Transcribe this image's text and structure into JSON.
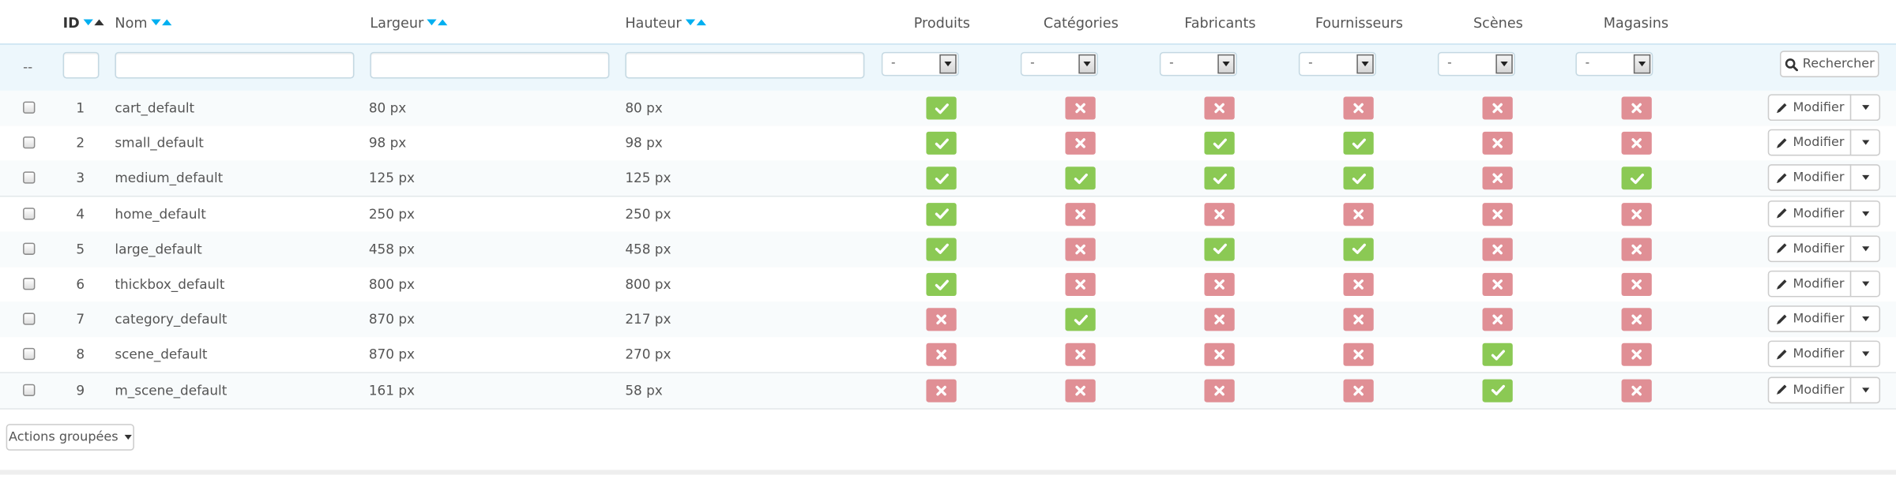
{
  "header": {
    "columns": [
      {
        "label": "ID"
      },
      {
        "label": "Nom"
      },
      {
        "label": "Largeur"
      },
      {
        "label": "Hauteur"
      },
      {
        "label": "Produits"
      },
      {
        "label": "Catégories"
      },
      {
        "label": "Fabricants"
      },
      {
        "label": "Fournisseurs"
      },
      {
        "label": "Scènes"
      },
      {
        "label": "Magasins"
      }
    ]
  },
  "filters": {
    "dash": "--",
    "select_value": "-",
    "search_label": "Rechercher"
  },
  "rows": [
    {
      "id": "1",
      "name": "cart_default",
      "width": "80 px",
      "height": "80 px",
      "flags": [
        true,
        false,
        false,
        false,
        false,
        false
      ]
    },
    {
      "id": "2",
      "name": "small_default",
      "width": "98 px",
      "height": "98 px",
      "flags": [
        true,
        false,
        true,
        true,
        false,
        false
      ]
    },
    {
      "id": "3",
      "name": "medium_default",
      "width": "125 px",
      "height": "125 px",
      "flags": [
        true,
        true,
        true,
        true,
        false,
        true
      ]
    },
    {
      "id": "4",
      "name": "home_default",
      "width": "250 px",
      "height": "250 px",
      "flags": [
        true,
        false,
        false,
        false,
        false,
        false
      ]
    },
    {
      "id": "5",
      "name": "large_default",
      "width": "458 px",
      "height": "458 px",
      "flags": [
        true,
        false,
        true,
        true,
        false,
        false
      ]
    },
    {
      "id": "6",
      "name": "thickbox_default",
      "width": "800 px",
      "height": "800 px",
      "flags": [
        true,
        false,
        false,
        false,
        false,
        false
      ]
    },
    {
      "id": "7",
      "name": "category_default",
      "width": "870 px",
      "height": "217 px",
      "flags": [
        false,
        true,
        false,
        false,
        false,
        false
      ]
    },
    {
      "id": "8",
      "name": "scene_default",
      "width": "870 px",
      "height": "270 px",
      "flags": [
        false,
        false,
        false,
        false,
        true,
        false
      ]
    },
    {
      "id": "9",
      "name": "m_scene_default",
      "width": "161 px",
      "height": "58 px",
      "flags": [
        false,
        false,
        false,
        false,
        true,
        false
      ]
    }
  ],
  "row_actions": {
    "edit_label": "Modifier"
  },
  "bulk": {
    "label": "Actions groupées"
  },
  "colors": {
    "yes": "#8bc954",
    "no": "#e08f95",
    "sort_arrow": "#00aff0",
    "filter_bg": "#edf7fc"
  },
  "icons": {
    "yes": "check-icon",
    "no": "cross-icon",
    "edit": "pencil-icon",
    "search": "search-icon"
  }
}
